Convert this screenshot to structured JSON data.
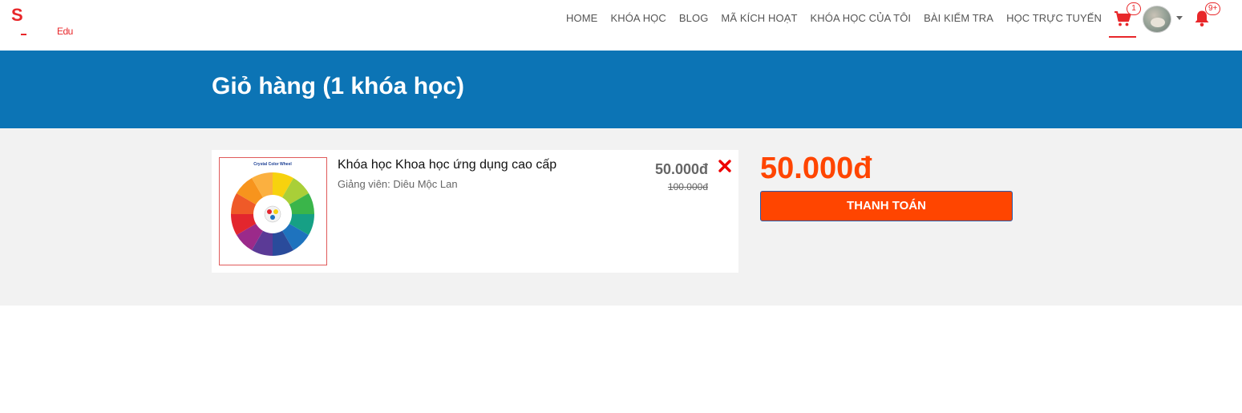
{
  "logo": {
    "mark": "S",
    "brand_suffix": "Edu"
  },
  "nav": {
    "items": [
      "HOME",
      "KHÓA HỌC",
      "BLOG",
      "MÃ KÍCH HOẠT",
      "KHÓA HỌC CỦA TÔI",
      "BÀI KIỂM TRA",
      "HỌC TRỰC TUYẾN"
    ]
  },
  "cart": {
    "icon": "shopping-cart-icon",
    "count": "1"
  },
  "notifications": {
    "icon": "bell-icon",
    "count": "9+"
  },
  "colors": {
    "accent": "#e8272a",
    "banner": "#0c74b5",
    "price": "#ff4500",
    "background": "#f2f2f2"
  },
  "page": {
    "title": "Giỏ hàng (1 khóa học)"
  },
  "cart_items": [
    {
      "title": "Khóa học Khoa học ứng dụng cao cấp",
      "teacher": "Giảng viên: Diêu Mộc Lan",
      "price": "50.000đ",
      "old_price": "100.000đ",
      "thumbnail_title": "Crystal Color Wheel"
    }
  ],
  "summary": {
    "total": "50.000đ",
    "checkout_label": "THANH TOÁN"
  }
}
